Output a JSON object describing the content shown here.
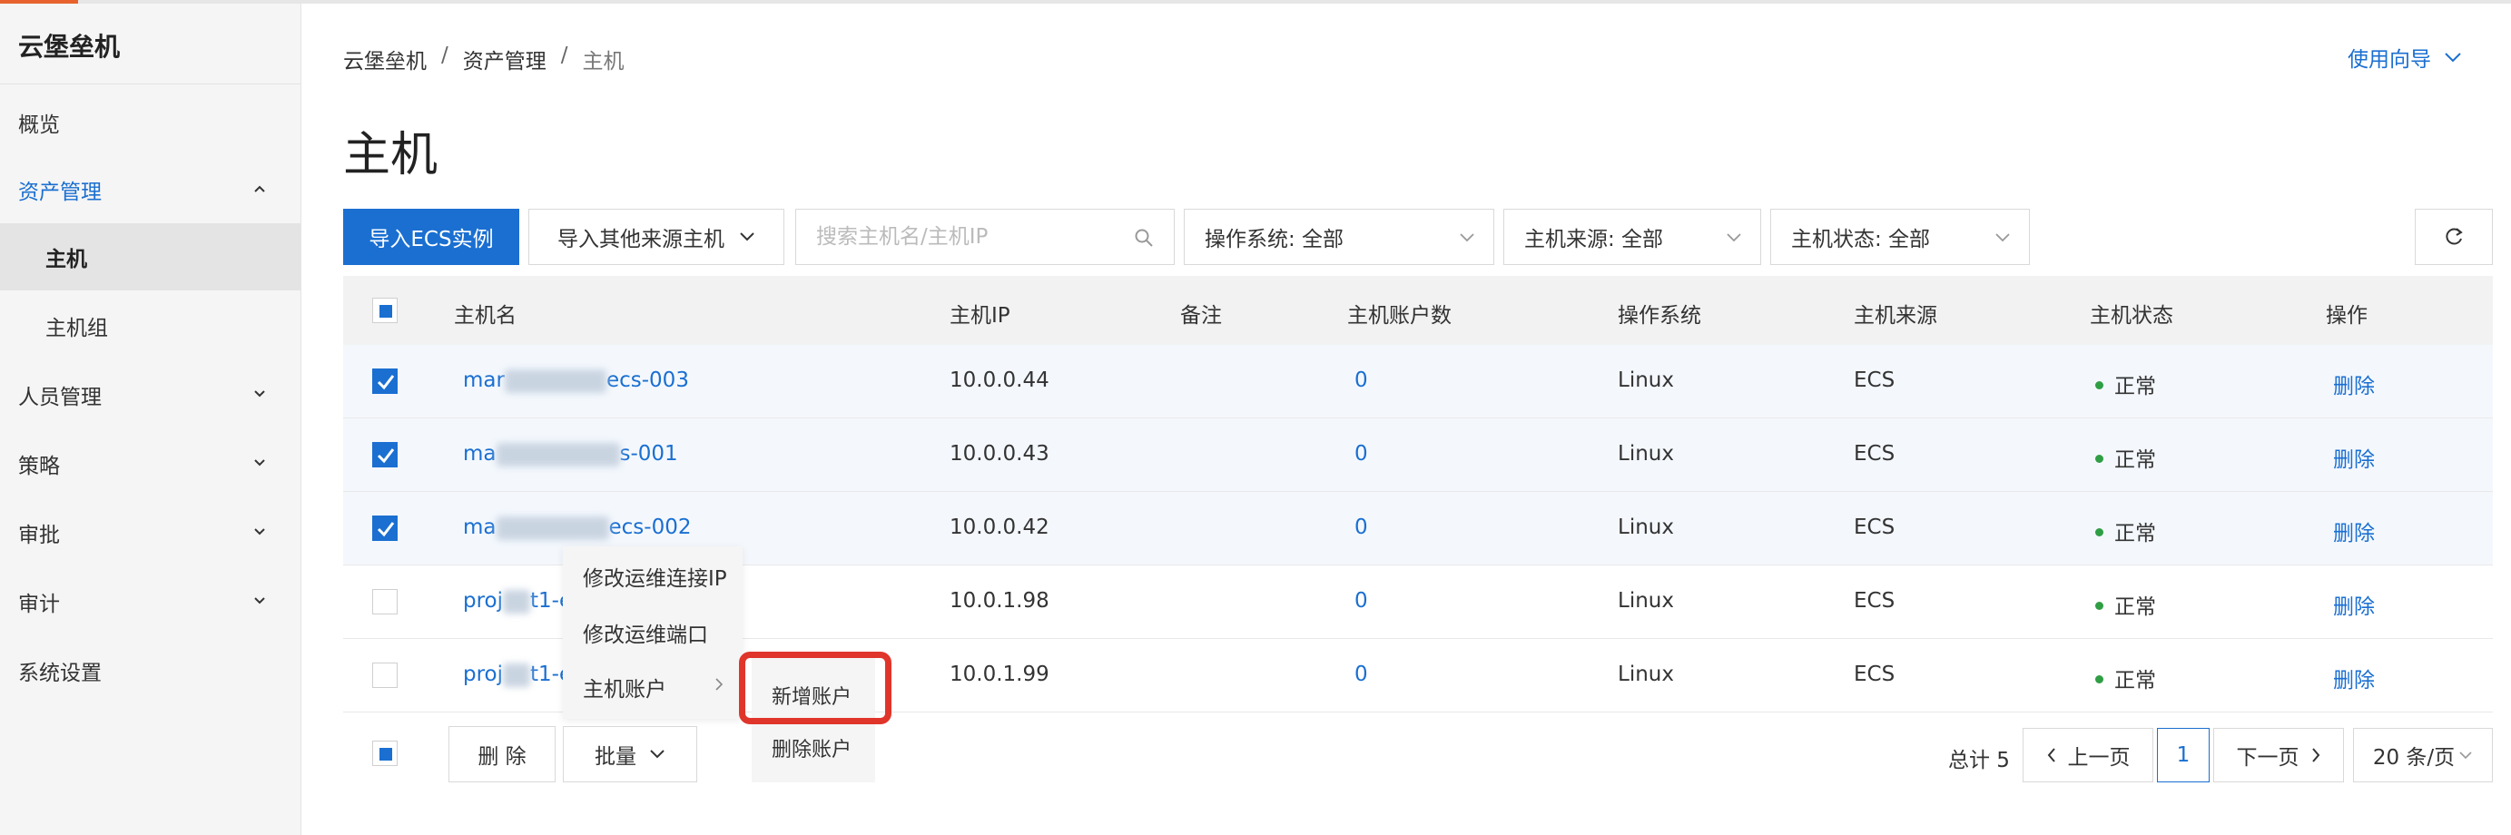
{
  "app": {
    "title": "云堡垒机"
  },
  "sidebar": {
    "items": [
      {
        "label": "概览"
      },
      {
        "label": "资产管理"
      },
      {
        "label": "主机"
      },
      {
        "label": "主机组"
      },
      {
        "label": "人员管理"
      },
      {
        "label": "策略"
      },
      {
        "label": "审批"
      },
      {
        "label": "审计"
      },
      {
        "label": "系统设置"
      }
    ]
  },
  "breadcrumb": {
    "root": "云堡垒机",
    "sep": "/",
    "parent": "资产管理",
    "current": "主机"
  },
  "header": {
    "guide_label": "使用向导",
    "page_title": "主机"
  },
  "toolbar": {
    "import_ecs": "导入ECS实例",
    "import_other": "导入其他来源主机",
    "search_placeholder": "搜索主机名/主机IP",
    "os_filter": "操作系统: 全部",
    "source_filter": "主机来源: 全部",
    "status_filter": "主机状态: 全部"
  },
  "table": {
    "columns": [
      "主机名",
      "主机IP",
      "备注",
      "主机账户数",
      "操作系统",
      "主机来源",
      "主机状态",
      "操作"
    ],
    "rows": [
      {
        "name_prefix": "mar",
        "name_suffix": "ecs-003",
        "ip": "10.0.0.44",
        "accounts": "0",
        "os": "Linux",
        "source": "ECS",
        "status": "正常",
        "action": "删除",
        "checked": true
      },
      {
        "name_prefix": "ma",
        "name_suffix": "s-001",
        "ip": "10.0.0.43",
        "accounts": "0",
        "os": "Linux",
        "source": "ECS",
        "status": "正常",
        "action": "删除",
        "checked": true
      },
      {
        "name_prefix": "ma",
        "name_suffix": "ecs-002",
        "ip": "10.0.0.42",
        "accounts": "0",
        "os": "Linux",
        "source": "ECS",
        "status": "正常",
        "action": "删除",
        "checked": true
      },
      {
        "name_prefix": "proj",
        "name_suffix": "t1-ec",
        "ip": "10.0.1.98",
        "accounts": "0",
        "os": "Linux",
        "source": "ECS",
        "status": "正常",
        "action": "删除",
        "checked": false
      },
      {
        "name_prefix": "proj",
        "name_suffix": "t1-ec",
        "ip": "10.0.1.99",
        "accounts": "0",
        "os": "Linux",
        "source": "ECS",
        "status": "正常",
        "action": "删除",
        "checked": false
      }
    ]
  },
  "bulk": {
    "delete_label": "删 除",
    "batch_label": "批量"
  },
  "context_menu": {
    "items": [
      "修改运维连接IP",
      "修改运维端口",
      "主机账户"
    ],
    "submenu": [
      "新增账户",
      "删除账户"
    ]
  },
  "pagination": {
    "total": "总计 5",
    "prev": "上一页",
    "page": "1",
    "next": "下一页",
    "page_size": "20 条/页"
  },
  "colors": {
    "accent": "#1a6fd1",
    "highlight": "#e0352b",
    "status_ok": "#2f9e44"
  }
}
